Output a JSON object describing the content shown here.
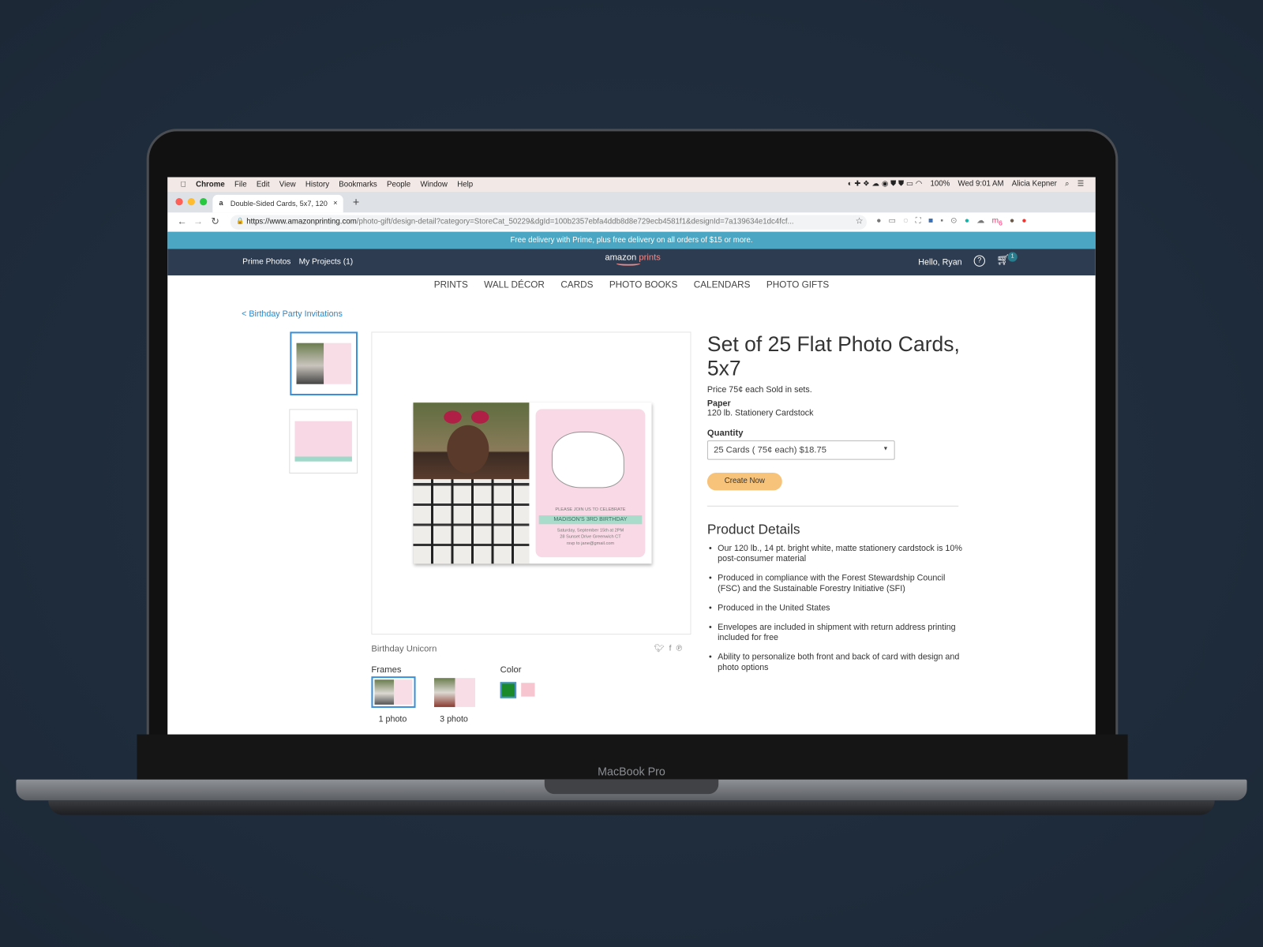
{
  "device": {
    "label": "MacBook Pro"
  },
  "menubar": {
    "apple": "",
    "items": [
      "Chrome",
      "File",
      "Edit",
      "View",
      "History",
      "Bookmarks",
      "People",
      "Window",
      "Help"
    ],
    "battery": "100%",
    "clock": "Wed 9:01 AM",
    "user": "Alicia Kepner"
  },
  "browser": {
    "tab_title": "Double-Sided Cards, 5x7, 120",
    "new_tab": "+",
    "close": "×",
    "url_host": "https://www.amazonprinting.com",
    "url_path": "/photo-gift/design-detail?category=StoreCat_50229&dgId=100b2357ebfa4ddb8d8e729ecb4581f1&designId=7a139634e1dc4fcf...",
    "extension_badge": "6"
  },
  "promo": "Free delivery with Prime, plus free delivery on all orders of $15 or more.",
  "nav": {
    "left": [
      "Prime Photos",
      "My Projects (1)"
    ],
    "logo_a": "amazon",
    "logo_b": "prints",
    "greeting": "Hello, Ryan",
    "help": "?",
    "cart_count": "1"
  },
  "categories": [
    "PRINTS",
    "WALL DÉCOR",
    "CARDS",
    "PHOTO BOOKS",
    "CALENDARS",
    "PHOTO GIFTS"
  ],
  "breadcrumb": "< Birthday Party Invitations",
  "card": {
    "line1": "PLEASE JOIN US TO CELEBRATE",
    "banner": "MADISON'S 3RD BIRTHDAY",
    "line2": "Saturday, September 15th at 2PM",
    "line3": "28 Sunset Drive Greenwich CT",
    "line4": "rsvp to jane@gmail.com"
  },
  "design_name": "Birthday Unicorn",
  "share_icons": [
    "twitter-icon",
    "facebook-icon",
    "pinterest-icon"
  ],
  "frames": {
    "label": "Frames",
    "options": [
      "1 photo",
      "3 photo"
    ],
    "selected": "1 photo"
  },
  "color": {
    "label": "Color",
    "options": [
      "#1a8a2a",
      "#f7c5cf"
    ],
    "selected": "#1a8a2a"
  },
  "product": {
    "title": "Set of 25 Flat Photo Cards, 5x7",
    "price": "Price 75¢ each Sold in sets.",
    "paper_label": "Paper",
    "paper": "120 lb. Stationery Cardstock",
    "quantity_label": "Quantity",
    "quantity": "25 Cards ( 75¢ each) $18.75",
    "cta": "Create Now"
  },
  "details": {
    "title": "Product Details",
    "items": [
      "Our 120 lb., 14 pt. bright white, matte stationery cardstock is 10% post-consumer material",
      "Produced in compliance with the Forest Stewardship Council (FSC) and the Sustainable Forestry Initiative (SFI)",
      "Produced in the United States",
      "Envelopes are included in shipment with return address printing included for free",
      "Ability to personalize both front and back of card with design and photo options"
    ]
  },
  "colors": {
    "promo": "#4aa6c2",
    "nav": "#2d3c50",
    "cta": "#f7c37a",
    "link": "#2d87c8"
  }
}
